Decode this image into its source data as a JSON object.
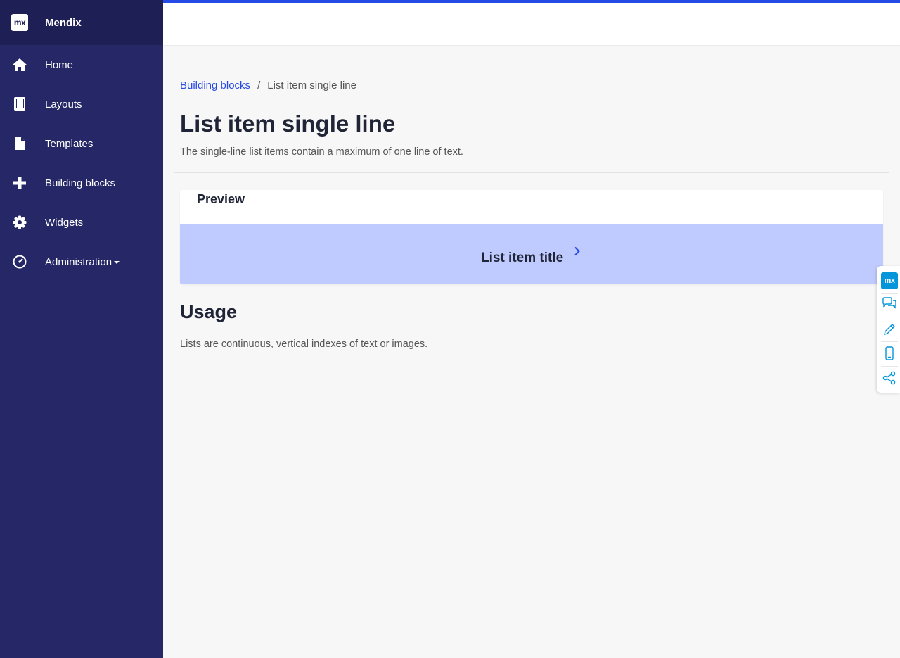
{
  "brand": {
    "logo_text": "mx",
    "name": "Mendix"
  },
  "sidebar": {
    "items": [
      {
        "label": "Home",
        "icon": "home-icon"
      },
      {
        "label": "Layouts",
        "icon": "book-icon"
      },
      {
        "label": "Templates",
        "icon": "file-icon"
      },
      {
        "label": "Building blocks",
        "icon": "plus-icon"
      },
      {
        "label": "Widgets",
        "icon": "gear-icon"
      },
      {
        "label": "Administration",
        "icon": "dashboard-icon",
        "has_dropdown": true
      }
    ]
  },
  "breadcrumb": {
    "parent": "Building blocks",
    "separator": "/",
    "current": "List item single line"
  },
  "page": {
    "title": "List item single line",
    "subtitle": "The single-line list items contain a maximum of one line of text."
  },
  "preview": {
    "header": "Preview",
    "list_item_title": "List item title"
  },
  "usage": {
    "title": "Usage",
    "text": "Lists are continuous, vertical indexes of text or images."
  },
  "dock": {
    "logo_text": "mx"
  },
  "colors": {
    "sidebar": "#252766",
    "brand_bar": "#1e1f55",
    "accent": "#264ae5",
    "preview_bg": "#bfcbfe",
    "dock_accent": "#0595db"
  }
}
